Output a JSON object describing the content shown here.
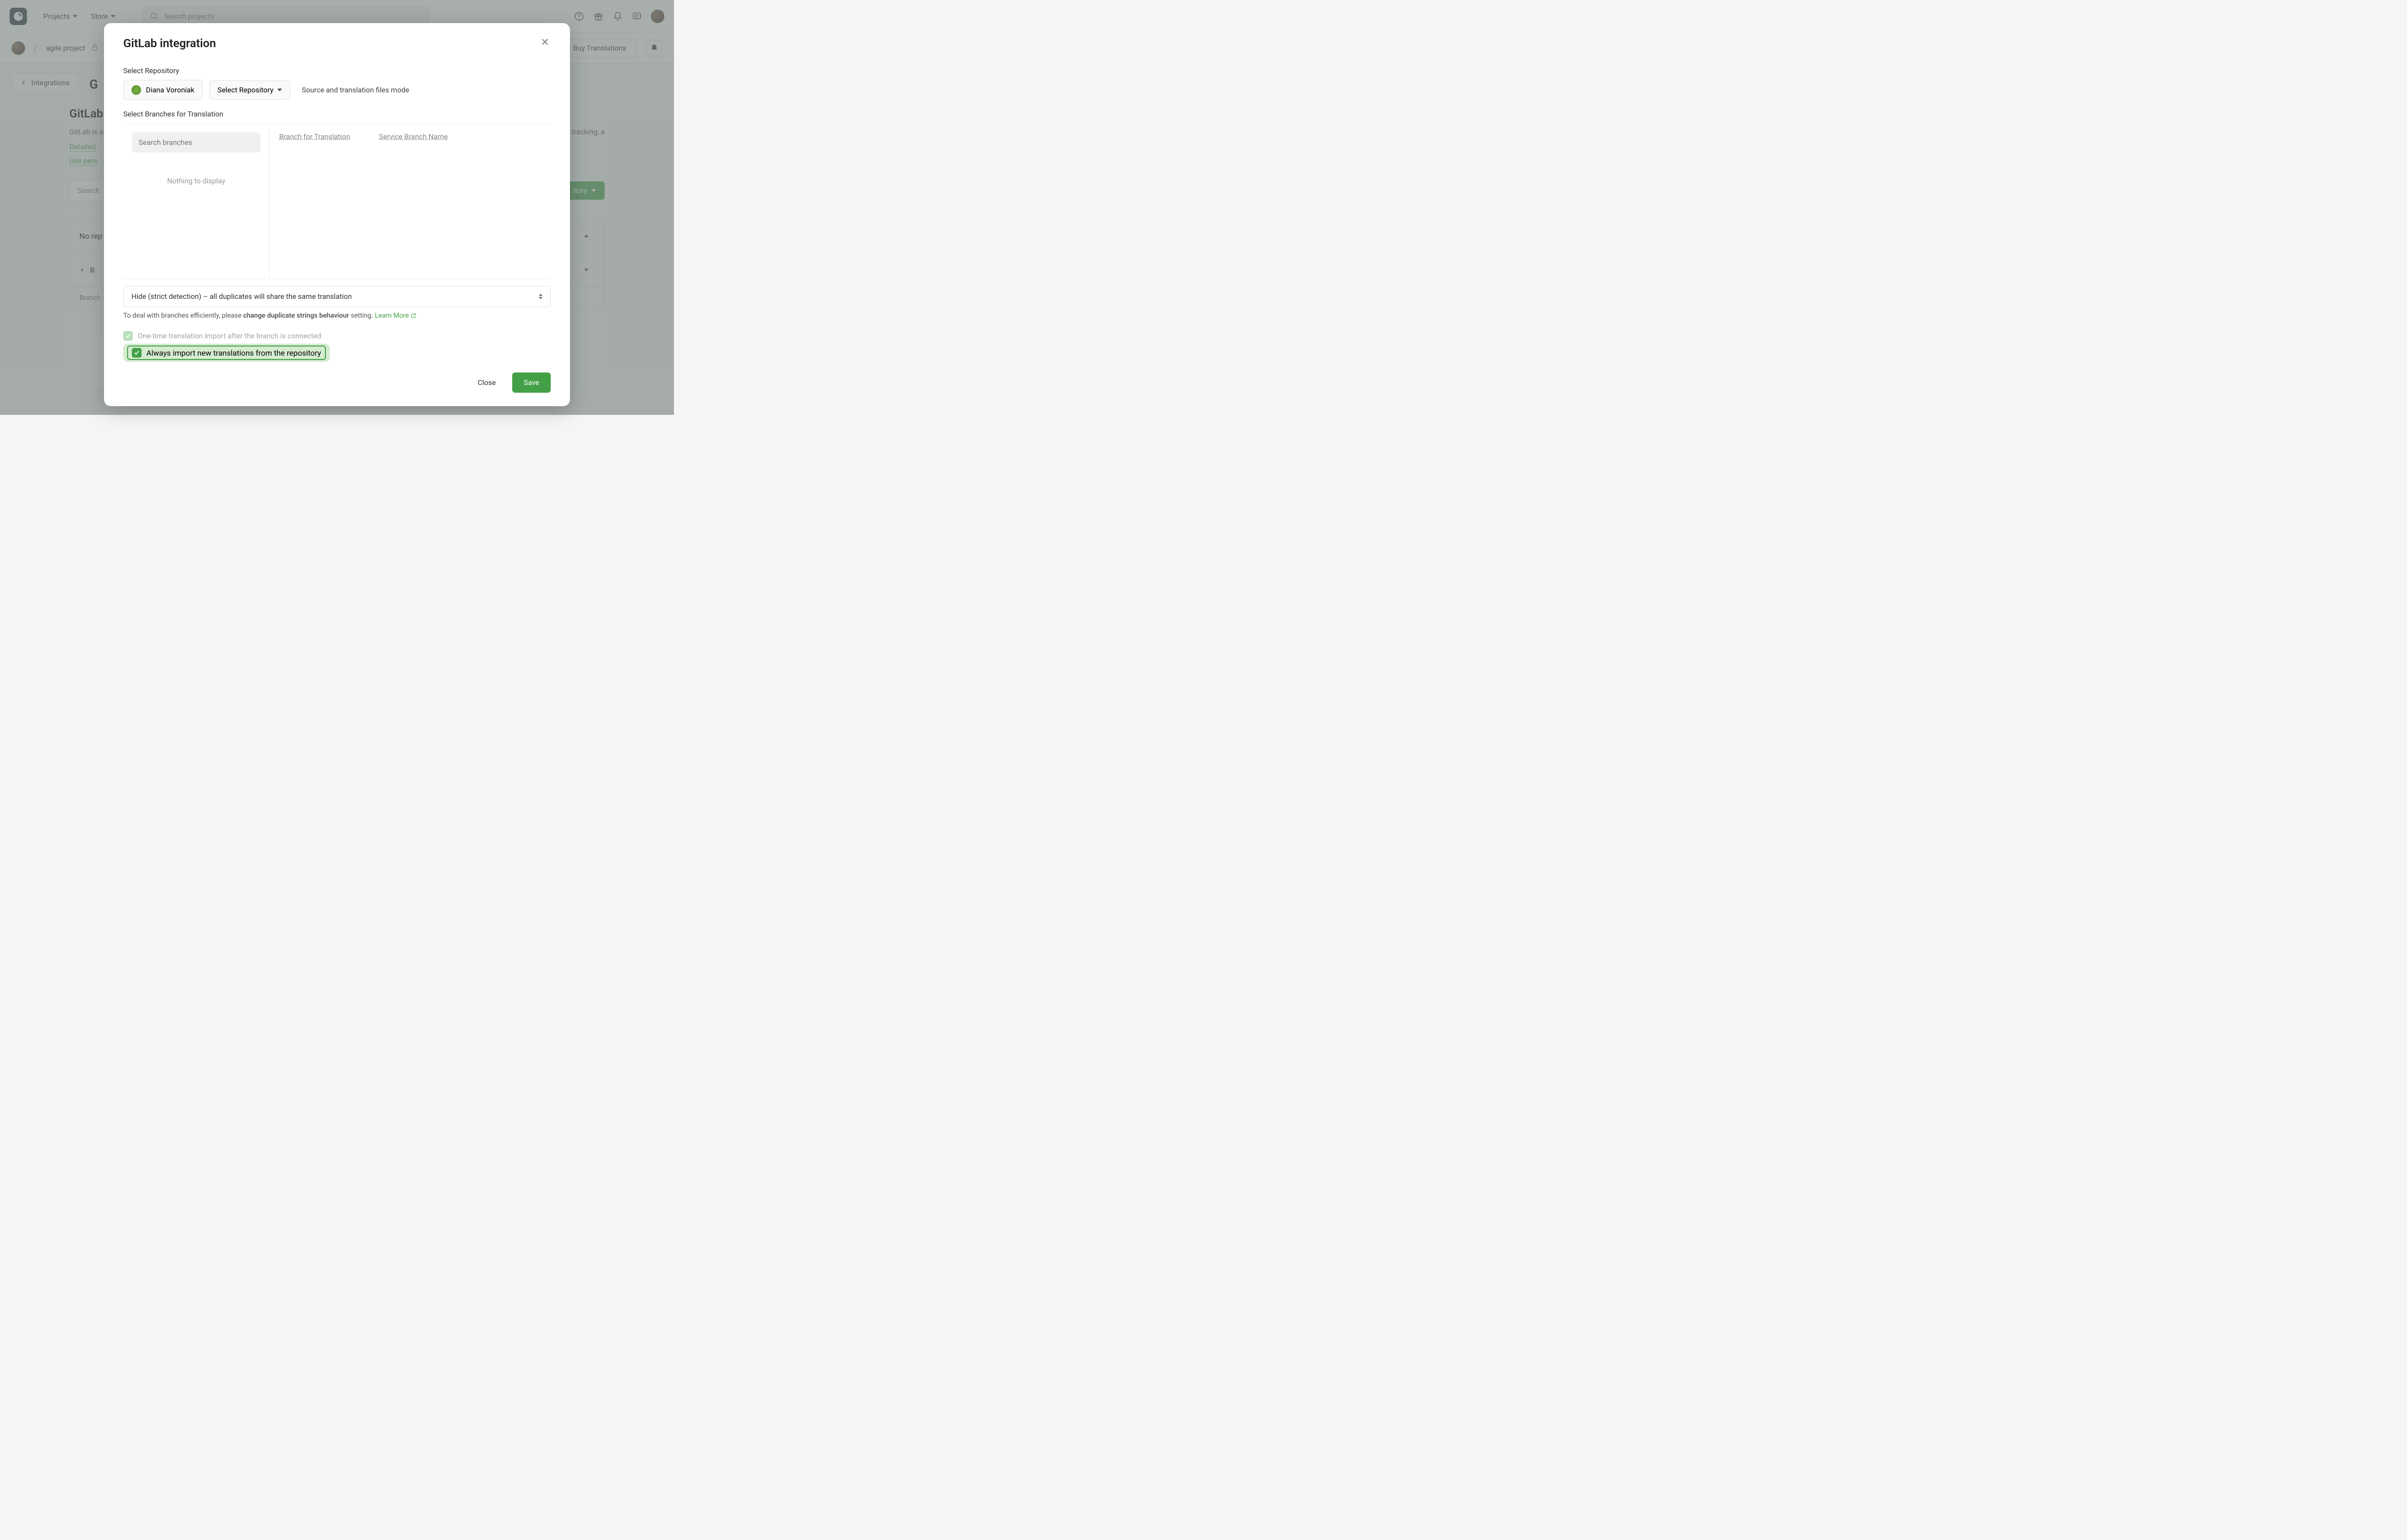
{
  "nav": {
    "projects": "Projects",
    "store": "Store",
    "search_placeholder": "Search projects"
  },
  "breadcrumb": {
    "project": "agile project",
    "buy": "Buy Translations"
  },
  "page": {
    "back": "Integrations",
    "title_prefix": "G",
    "gitlab_heading": "GitLab",
    "gitlab_desc_start": "GitLab is a",
    "gitlab_desc_end": "s, issue tracking, a",
    "detailed": "Detailed",
    "use_personal": "Use pers",
    "search_placeholder": "Search",
    "no_repo": "No rep",
    "re_text": "R",
    "branch_label": "Branch",
    "add_repo": "itory"
  },
  "modal": {
    "title": "GitLab integration",
    "select_repo_label": "Select Repository",
    "user": "Diana Voroniak",
    "select_repo_btn": "Select Repository",
    "mode": "Source and translation files mode",
    "select_branches_label": "Select Branches for Translation",
    "branch_search_placeholder": "Search branches",
    "nothing": "Nothing to display",
    "branch_for_translation": "Branch for Translation",
    "service_branch": "Service Branch Name",
    "dup_select": "Hide (strict detection) – all duplicates will share the same translation",
    "dup_note_a": "To deal with branches efficiently, please ",
    "dup_note_b": "change duplicate strings behaviour",
    "dup_note_c": " setting. ",
    "dup_learn": "Learn More",
    "check1": "One-time translation import after the branch is connected",
    "check2": "Always import new translations from the repository",
    "close": "Close",
    "save": "Save"
  }
}
